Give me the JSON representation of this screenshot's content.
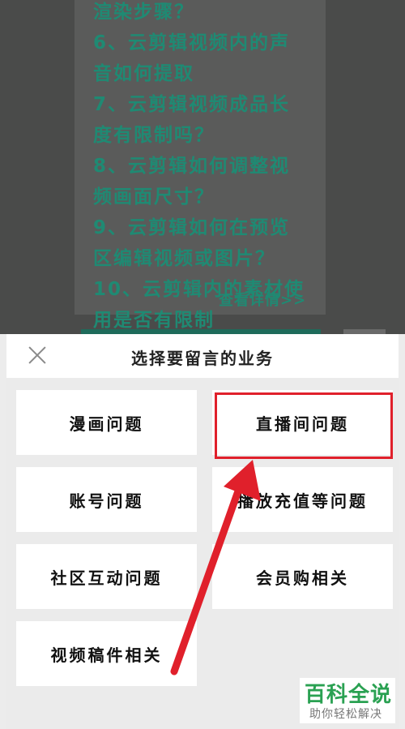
{
  "background_faq": {
    "lines": [
      "渲染步骤？",
      "6、云剪辑视频内的声",
      "音如何提取",
      "7、云剪辑视频成品长",
      "度有限制吗？",
      "8、云剪辑如何调整视",
      "频画面尺寸？",
      "9、云剪辑如何在预览",
      "区编辑视频或图片？",
      "10、云剪辑内的素材使",
      "用是否有限制"
    ],
    "more_link": "查看详情>>"
  },
  "sheet": {
    "title": "选择要留言的业务",
    "options": [
      "漫画问题",
      "直播间问题",
      "账号问题",
      "播放充值等问题",
      "社区互动问题",
      "会员购相关",
      "视频稿件相关"
    ]
  },
  "watermark": {
    "title": "百科全说",
    "subtitle": "助你轻松解决"
  },
  "colors": {
    "highlight": "#e0202b",
    "faq_text": "#1f8a73",
    "watermark_green": "#2aa152"
  }
}
